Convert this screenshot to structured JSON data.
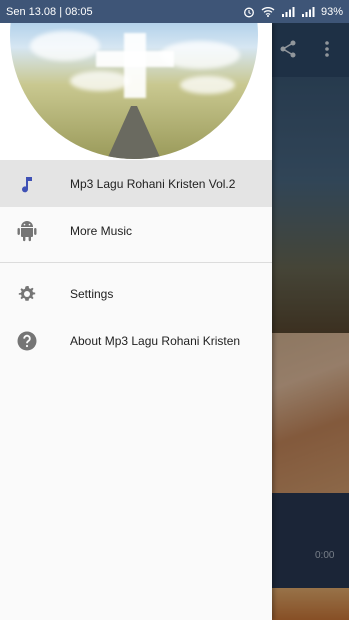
{
  "status_bar": {
    "left": "Sen 13.08 | 08:05",
    "battery": "93%"
  },
  "background": {
    "time": "0:00"
  },
  "drawer": {
    "items": [
      {
        "label": "Mp3 Lagu Rohani Kristen Vol.2",
        "icon": "music-note-icon",
        "active": true
      },
      {
        "label": "More Music",
        "icon": "android-icon",
        "active": false
      }
    ],
    "secondary_items": [
      {
        "label": "Settings",
        "icon": "gear-icon"
      },
      {
        "label": "About Mp3 Lagu Rohani Kristen",
        "icon": "help-icon"
      }
    ]
  },
  "colors": {
    "status_bar": "#3e5577",
    "accent": "#3f51b5",
    "icon_gray": "#757575",
    "active_bg": "#e4e4e4"
  }
}
